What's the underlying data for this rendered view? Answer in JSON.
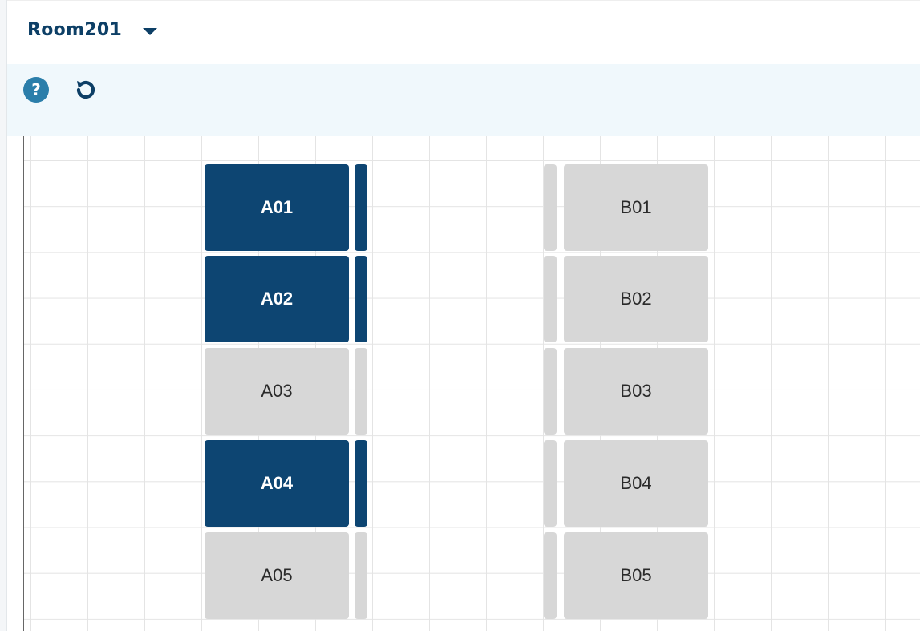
{
  "header": {
    "room_name": "Room201",
    "dropdown_icon": "caret-down-icon"
  },
  "toolbar": {
    "help_icon": "question-circle-icon",
    "help_glyph": "?",
    "refresh_icon": "refresh-icon"
  },
  "seats": {
    "column_a": [
      {
        "label": "A01",
        "status": "selected"
      },
      {
        "label": "A02",
        "status": "selected"
      },
      {
        "label": "A03",
        "status": "available"
      },
      {
        "label": "A04",
        "status": "selected"
      },
      {
        "label": "A05",
        "status": "available"
      }
    ],
    "column_b": [
      {
        "label": "B01",
        "status": "available"
      },
      {
        "label": "B02",
        "status": "available"
      },
      {
        "label": "B03",
        "status": "available"
      },
      {
        "label": "B04",
        "status": "available"
      },
      {
        "label": "B05",
        "status": "available"
      }
    ]
  },
  "colors": {
    "selected": "#0d4572",
    "available": "#d7d7d7",
    "accent": "#0d3f66",
    "toolbar_bg": "#f0f8fc",
    "help_icon": "#2b7eaa"
  }
}
